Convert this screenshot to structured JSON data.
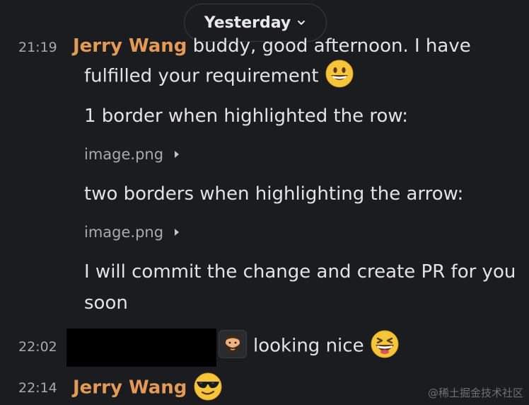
{
  "date_divider": {
    "label": "Yesterday"
  },
  "messages": [
    {
      "time": "21:19",
      "author": "Jerry Wang",
      "line1": "buddy, good afternoon. I have",
      "line2": "fulfilled your requirement",
      "line2_emoji": "grinning-face-icon",
      "text2": "1 border when highlighted the row:",
      "attachment1": "image.png",
      "text3": "two borders when highlighting the arrow:",
      "attachment2": "image.png",
      "text4_line1": "I will commit the change and create PR for you",
      "text4_line2": "soon"
    },
    {
      "time": "22:02",
      "author_redacted": true,
      "avatar_icon": "bearded-man-icon",
      "text": "looking nice",
      "emoji": "grinning-squinting-face-icon"
    },
    {
      "time": "22:14",
      "author": "Jerry Wang",
      "emoji": "sunglasses-face-icon"
    }
  ],
  "watermark": "@稀土掘金技术社区",
  "colors": {
    "background": "#1b1c1f",
    "author": "#e49a55",
    "text": "#e3e3e3",
    "muted": "#a9aaad"
  }
}
